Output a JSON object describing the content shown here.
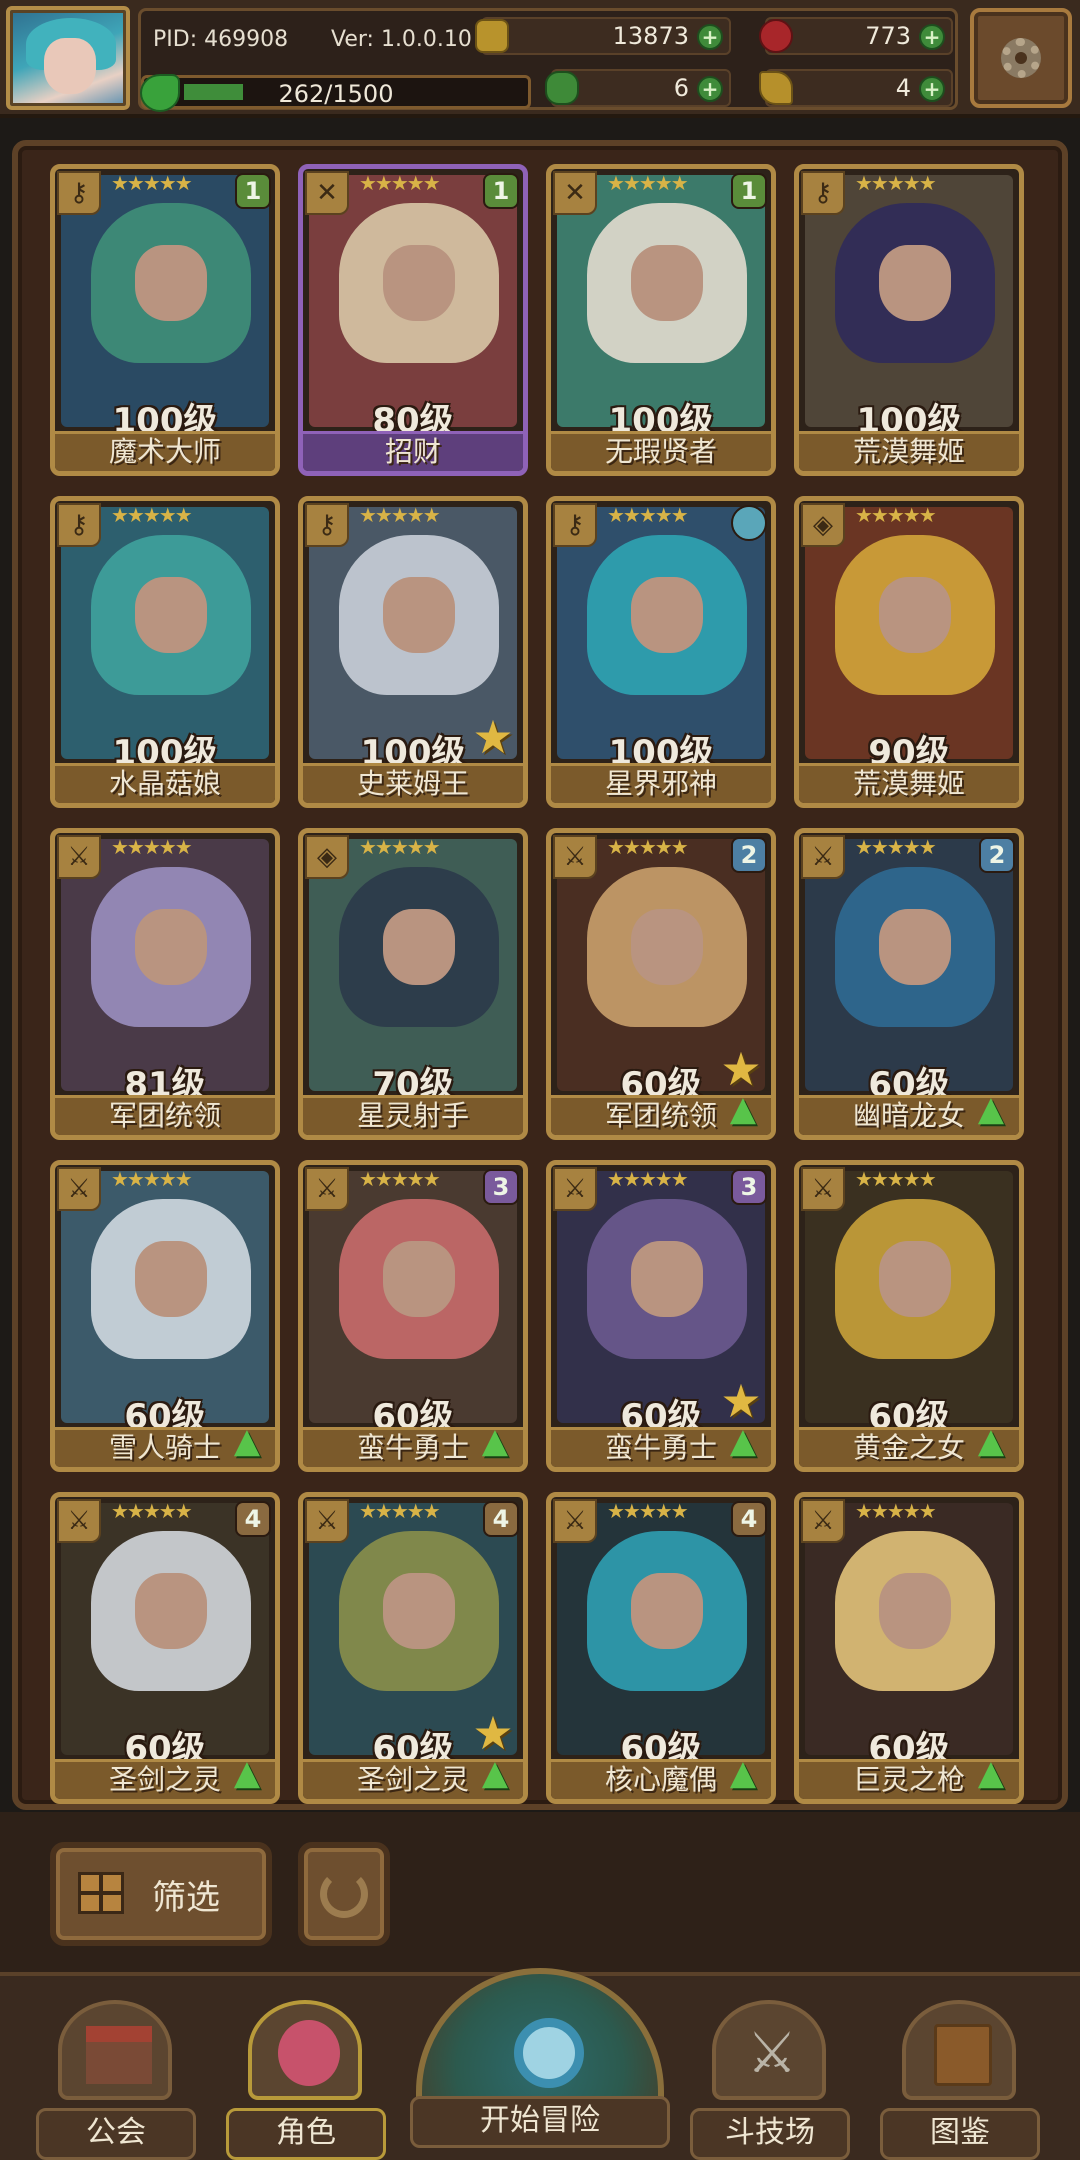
{
  "header": {
    "pid": "PID: 469908",
    "version": "Ver: 1.0.0.10",
    "exp_text": "262/1500",
    "exp_progress": 0.1747,
    "gold": "13873",
    "gems": "773",
    "clovers": "6",
    "keys": "4"
  },
  "cards": [
    {
      "level": "100级",
      "name": "魔术大师",
      "badge": "1",
      "badge_style": "green",
      "frame": "gold",
      "hair": "#3f8f78",
      "bg": "#2a4a63",
      "class": "key"
    },
    {
      "level": "80级",
      "name": "招财",
      "badge": "1",
      "badge_style": "green",
      "frame": "purple",
      "hair": "#d8c6a6",
      "bg": "#7a3e3e",
      "class": "cross"
    },
    {
      "level": "100级",
      "name": "无瑕贤者",
      "badge": "1",
      "badge_style": "green",
      "frame": "gold",
      "hair": "#e2dccf",
      "bg": "#3c7a6a",
      "class": "cross"
    },
    {
      "level": "100级",
      "name": "荒漠舞姬",
      "badge": "",
      "badge_style": "",
      "frame": "gold",
      "hair": "#2f2a5a",
      "bg": "#4f4538",
      "class": "key"
    },
    {
      "level": "100级",
      "name": "水晶菇娘",
      "badge": "",
      "badge_style": "",
      "frame": "gold",
      "hair": "#3fa29c",
      "bg": "#2d5f6e",
      "class": "key"
    },
    {
      "level": "100级",
      "name": "史莱姆王",
      "badge": "",
      "badge_style": "",
      "frame": "gold",
      "hair": "#c9cfd8",
      "bg": "#4a5866",
      "class": "key",
      "fav": true
    },
    {
      "level": "100级",
      "name": "星界邪神",
      "badge": "",
      "badge_style": "orb",
      "frame": "gold",
      "hair": "#2fa3b3",
      "bg": "#2f4f6b",
      "class": "key"
    },
    {
      "level": "90级",
      "name": "荒漠舞姬",
      "badge": "",
      "badge_style": "",
      "frame": "gold",
      "hair": "#d3a43a",
      "bg": "#6a3523",
      "class": "shield"
    },
    {
      "level": "81级",
      "name": "军团统领",
      "badge": "",
      "badge_style": "",
      "frame": "gold",
      "hair": "#9a8fbf",
      "bg": "#4a3a48",
      "class": "sword"
    },
    {
      "level": "70级",
      "name": "星灵射手",
      "badge": "",
      "badge_style": "",
      "frame": "gold",
      "hair": "#2b3a4a",
      "bg": "#3f5d55",
      "class": "shield"
    },
    {
      "level": "60级",
      "name": "军团统领",
      "badge": "2",
      "badge_style": "blue",
      "frame": "gold",
      "hair": "#c9a06b",
      "bg": "#4a2e22",
      "class": "sword",
      "fav": true,
      "up": true
    },
    {
      "level": "60级",
      "name": "幽暗龙女",
      "badge": "2",
      "badge_style": "blue",
      "frame": "gold",
      "hair": "#2f6a92",
      "bg": "#2c3a4a",
      "class": "sword",
      "up": true
    },
    {
      "level": "60级",
      "name": "雪人骑士",
      "badge": "",
      "badge_style": "",
      "frame": "gold",
      "hair": "#cfd8e0",
      "bg": "#3c5a6a",
      "class": "sword",
      "up": true
    },
    {
      "level": "60级",
      "name": "蛮牛勇士",
      "badge": "3",
      "badge_style": "purple",
      "frame": "gold",
      "hair": "#c86b6b",
      "bg": "#4a3a30",
      "class": "sword",
      "up": true
    },
    {
      "level": "60级",
      "name": "蛮牛勇士",
      "badge": "3",
      "badge_style": "purple",
      "frame": "gold",
      "hair": "#6a5a8f",
      "bg": "#32304a",
      "class": "sword",
      "fav": true,
      "up": true
    },
    {
      "level": "60级",
      "name": "黄金之女",
      "badge": "",
      "badge_style": "",
      "frame": "gold",
      "hair": "#c9a23a",
      "bg": "#3a3020",
      "class": "sword",
      "up": true
    },
    {
      "level": "60级",
      "name": "圣剑之灵",
      "badge": "4",
      "badge_style": "tan",
      "frame": "gold",
      "hair": "#d3d6dc",
      "bg": "#3b3326",
      "class": "sword",
      "up": true
    },
    {
      "level": "60级",
      "name": "圣剑之灵",
      "badge": "4",
      "badge_style": "tan",
      "frame": "gold",
      "hair": "#8a8f4a",
      "bg": "#2c4a52",
      "class": "sword",
      "fav": true,
      "up": true
    },
    {
      "level": "60级",
      "name": "核心魔偶",
      "badge": "4",
      "badge_style": "tan",
      "frame": "gold",
      "hair": "#2f9fb3",
      "bg": "#24343a",
      "class": "sword",
      "up": true
    },
    {
      "level": "60级",
      "name": "巨灵之枪",
      "badge": "",
      "badge_style": "",
      "frame": "gold",
      "hair": "#e2c27a",
      "bg": "#3a2a24",
      "class": "sword",
      "up": true
    }
  ],
  "filter": {
    "label": "筛选"
  },
  "nav": {
    "guild": "公会",
    "character": "角色",
    "adventure": "开始冒险",
    "arena": "斗技场",
    "codex": "图鉴"
  },
  "icons": {
    "gold": "gold-coin-icon",
    "gem": "red-gem-icon",
    "clover": "clover-icon",
    "key": "key-icon",
    "settings": "gear-icon"
  }
}
